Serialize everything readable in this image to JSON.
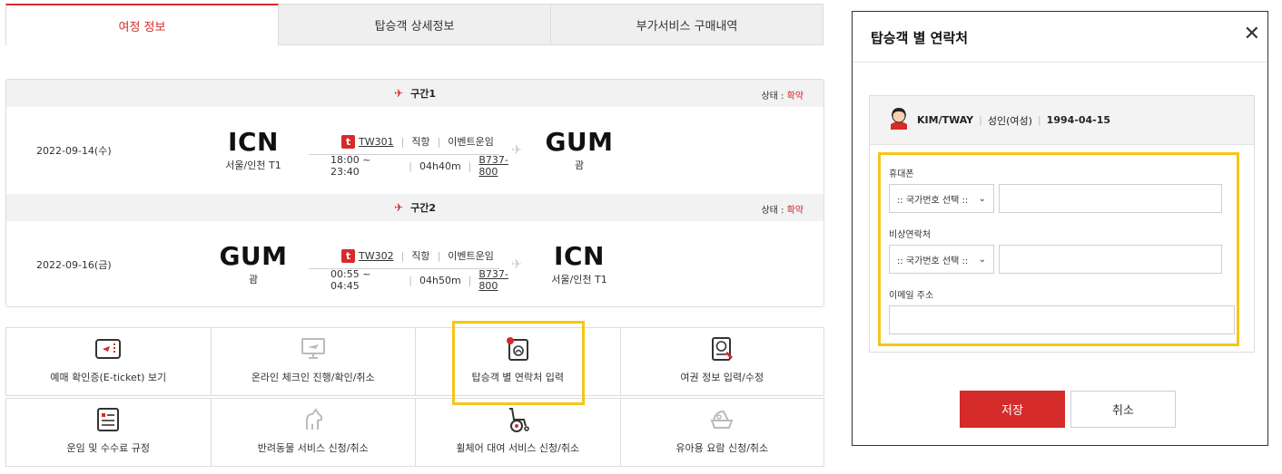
{
  "tabs": [
    {
      "label": "여정 정보"
    },
    {
      "label": "탑승객 상세정보"
    },
    {
      "label": "부가서비스 구매내역"
    }
  ],
  "segments": [
    {
      "title": "구간1",
      "status_label": "상태 : ",
      "status_value": "확약",
      "date": "2022-09-14(수)",
      "from_code": "ICN",
      "from_city": "서울/인천 T1",
      "to_code": "GUM",
      "to_city": "괌",
      "flight_no": "TW301",
      "direct": "직항",
      "fare": "이벤트운임",
      "time": "18:00 ~ 23:40",
      "duration": "04h40m",
      "aircraft": "B737-800"
    },
    {
      "title": "구간2",
      "status_label": "상태 : ",
      "status_value": "확약",
      "date": "2022-09-16(금)",
      "from_code": "GUM",
      "from_city": "괌",
      "to_code": "ICN",
      "to_city": "서울/인천 T1",
      "flight_no": "TW302",
      "direct": "직항",
      "fare": "이벤트운임",
      "time": "00:55 ~ 04:45",
      "duration": "04h50m",
      "aircraft": "B737-800"
    }
  ],
  "services": [
    {
      "label": "예매 확인증(E-ticket) 보기",
      "icon": "ticket-icon"
    },
    {
      "label": "온라인 체크인 진행/확인/취소",
      "icon": "monitor-plane-icon"
    },
    {
      "label": "탑승객 별 연락처 입력",
      "icon": "contact-card-icon"
    },
    {
      "label": "여권 정보 입력/수정",
      "icon": "passport-icon"
    },
    {
      "label": "운임 및 수수료 규정",
      "icon": "document-icon"
    },
    {
      "label": "반려동물 서비스 신청/취소",
      "icon": "dog-icon"
    },
    {
      "label": "휠체어 대여 서비스 신청/취소",
      "icon": "wheelchair-icon"
    },
    {
      "label": "유아용 요람 신청/취소",
      "icon": "bassinet-icon"
    }
  ],
  "modal": {
    "title": "탑승객 별 연락처",
    "passenger_name": "KIM/TWAY",
    "passenger_type": "성인(여성)",
    "passenger_dob": "1994-04-15",
    "mobile_label": "휴대폰",
    "emergency_label": "비상연락처",
    "email_label": "이메일 주소",
    "country_select": ":: 국가번호 선택 ::",
    "save_label": "저장",
    "cancel_label": "취소"
  },
  "colors": {
    "accent": "#d62b2b",
    "highlight": "#f5c518"
  }
}
